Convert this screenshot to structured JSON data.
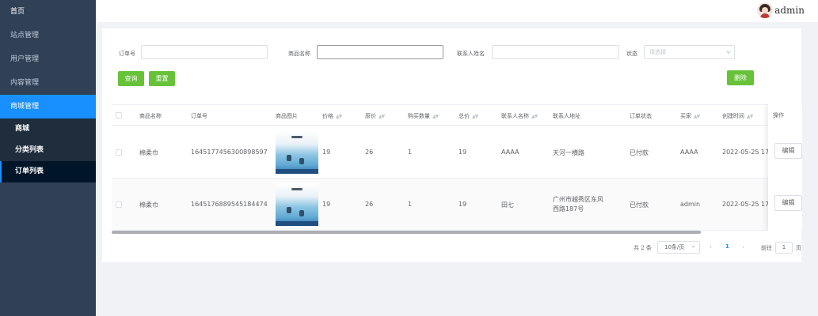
{
  "sidebar": {
    "items": [
      {
        "label": "首页"
      },
      {
        "label": "站点管理"
      },
      {
        "label": "用户管理"
      },
      {
        "label": "内容管理"
      },
      {
        "label": "商城管理"
      }
    ],
    "subitems": [
      {
        "label": "商城"
      },
      {
        "label": "分类列表"
      },
      {
        "label": "订单列表"
      }
    ]
  },
  "header": {
    "username": "admin"
  },
  "search": {
    "order_no_label": "订单号",
    "product_name_label": "商品名称",
    "contact_name_label": "联系人姓名",
    "status_label": "状态",
    "status_placeholder": "请选择"
  },
  "buttons": {
    "query": "查询",
    "reset": "重置",
    "delete": "删除"
  },
  "table": {
    "columns": {
      "product_name": "商品名称",
      "order_no": "订单号",
      "product_image": "商品图片",
      "price": "价格",
      "original_price": "原价",
      "quantity": "购买数量",
      "total": "总价",
      "contact_name": "联系人名称",
      "contact_address": "联系人地址",
      "order_status": "订单状态",
      "buyer": "买家",
      "created_time": "创建时间",
      "actions": "操作"
    },
    "rows": [
      {
        "product_name": "棉柔巾",
        "order_no": "1645177456300898597",
        "price": "19",
        "original_price": "26",
        "quantity": "1",
        "total": "19",
        "contact_name": "AAAA",
        "contact_address": "天河一横路",
        "order_status": "已付款",
        "buyer": "AAAA",
        "created_time": "2022-05-25 17",
        "edit": "编辑"
      },
      {
        "product_name": "棉柔巾",
        "order_no": "1645176889545184474",
        "price": "19",
        "original_price": "26",
        "quantity": "1",
        "total": "19",
        "contact_name": "田七",
        "contact_address": "广州市越秀区东风西路187号",
        "order_status": "已付款",
        "buyer": "admin",
        "created_time": "2022-05-25 17",
        "edit": "编辑"
      }
    ]
  },
  "pagination": {
    "total_text": "共 2 条",
    "page_size": "10条/页",
    "current_page": "1",
    "goto_label": "前往",
    "goto_value": "1",
    "page_suffix": "页",
    "prev_icon": "‹",
    "next_icon": "›"
  },
  "colors": {
    "sidebar_bg": "#304156",
    "active_blue": "#1890ff",
    "success_green": "#67c23a"
  }
}
